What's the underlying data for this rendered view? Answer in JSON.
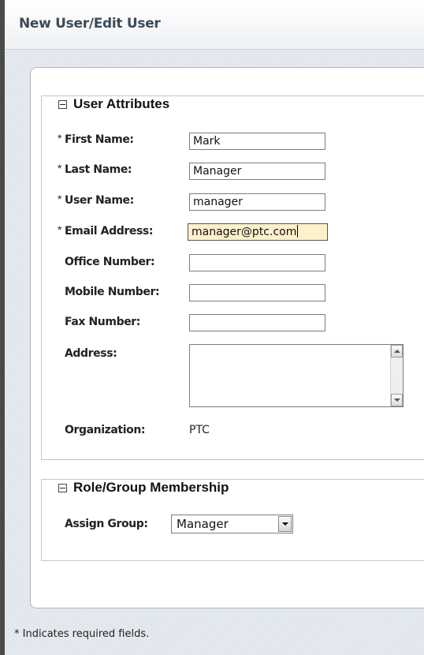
{
  "window": {
    "title": "New User/Edit User"
  },
  "user_attributes": {
    "legend": "User Attributes",
    "required_mark": "*",
    "first_name": {
      "label": "First Name:",
      "value": "Mark"
    },
    "last_name": {
      "label": "Last Name:",
      "value": "Manager"
    },
    "user_name": {
      "label": "User Name:",
      "value": "manager"
    },
    "email": {
      "label": "Email Address:",
      "value": "manager@ptc.com"
    },
    "office_number": {
      "label": "Office Number:",
      "value": ""
    },
    "mobile_number": {
      "label": "Mobile Number:",
      "value": ""
    },
    "fax_number": {
      "label": "Fax Number:",
      "value": ""
    },
    "address": {
      "label": "Address:",
      "value": ""
    },
    "organization": {
      "label": "Organization:",
      "value": "PTC"
    }
  },
  "role_group": {
    "legend": "Role/Group Membership",
    "assign_group": {
      "label": "Assign Group:",
      "selected": "Manager"
    }
  },
  "footer": {
    "note": "* Indicates required fields."
  }
}
